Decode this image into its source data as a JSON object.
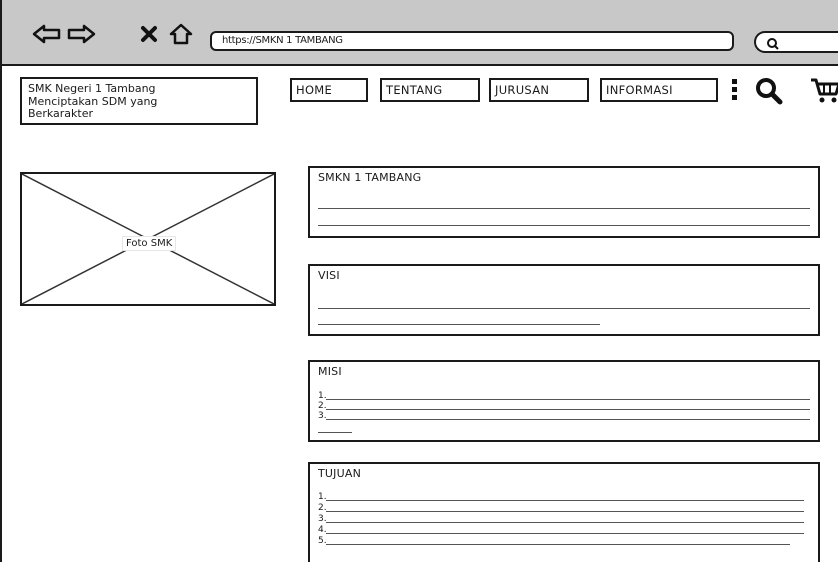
{
  "browser": {
    "url": "https://SMKN 1 TAMBANG",
    "icons": [
      "back-arrow-icon",
      "forward-arrow-icon",
      "close-icon",
      "home-icon",
      "search-icon"
    ]
  },
  "header": {
    "logo_lines": [
      "SMK Negeri 1 Tambang",
      "Menciptakan SDM yang",
      "Berkarakter"
    ],
    "nav": [
      "HOME",
      "TENTANG",
      "JURUSAN",
      "INFORMASI"
    ],
    "icons": [
      "more-vertical-icon",
      "search-icon",
      "cart-icon"
    ]
  },
  "photo": {
    "label": "Foto SMK"
  },
  "sections": [
    {
      "title": "SMKN 1 TAMBANG",
      "items": []
    },
    {
      "title": "VISI",
      "items": []
    },
    {
      "title": "MISI",
      "items": [
        "1.",
        "2.",
        "3."
      ]
    },
    {
      "title": "TUJUAN",
      "items": [
        "1.",
        "2.",
        "3.",
        "4.",
        "5."
      ]
    }
  ]
}
